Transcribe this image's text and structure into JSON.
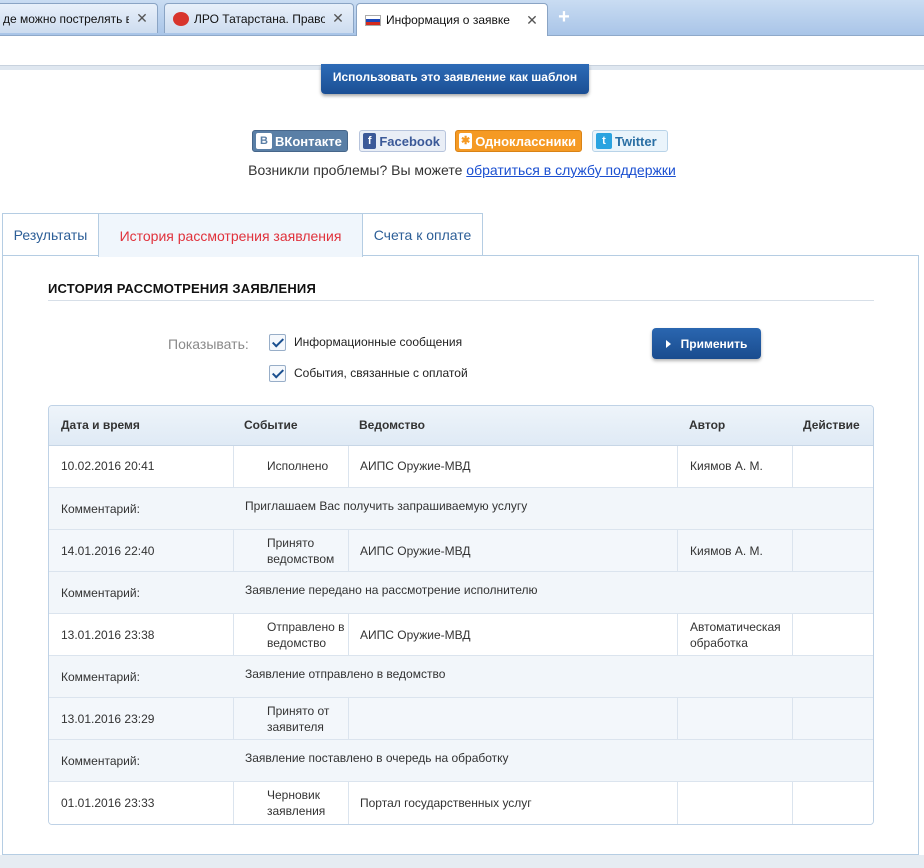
{
  "browser": {
    "tabs": [
      {
        "title": "де можно пострелять в "
      },
      {
        "title": "ЛРО Татарстана. Правово"
      },
      {
        "title": "Информация о заявке"
      }
    ],
    "new_tab": "+"
  },
  "page": {
    "template_button": "Использовать это заявление как шаблон",
    "share": {
      "vk": "ВКонтакте",
      "facebook": "Facebook",
      "ok": "Одноклассники",
      "twitter": "Twitter"
    },
    "support_text": "Возникли проблемы? Вы можете ",
    "support_link": "обратиться в службу поддержки",
    "tabs": [
      "Результаты",
      "История рассмотрения заявления",
      "Счета к оплате"
    ],
    "section_title": "ИСТОРИЯ РАССМОТРЕНИЯ ЗАЯВЛЕНИЯ",
    "filter": {
      "label": "Показывать:",
      "options": [
        "Информационные сообщения",
        "События, связанные с оплатой"
      ],
      "apply": "Применить"
    },
    "table": {
      "headers": [
        "Дата и время",
        "Событие",
        "Ведомство",
        "Автор",
        "Действие"
      ],
      "comment_label": "Комментарий:",
      "rows": [
        {
          "date": "10.02.2016 20:41",
          "event": "Исполнено",
          "agency": "АИПС Оружие-МВД",
          "author": "Киямов А. М.",
          "comment": "Приглашаем Вас получить запрашиваемую услугу"
        },
        {
          "date": "14.01.2016 22:40",
          "event": "Принято ведомством",
          "agency": "АИПС Оружие-МВД",
          "author": "Киямов А. М.",
          "comment": "Заявление передано на рассмотрение исполнителю"
        },
        {
          "date": "13.01.2016 23:38",
          "event": "Отправлено в ведомство",
          "agency": "АИПС Оружие-МВД",
          "author": "Автоматическая обработка",
          "comment": "Заявление отправлено в ведомство"
        },
        {
          "date": "13.01.2016 23:29",
          "event": "Принято от заявителя",
          "agency": "",
          "author": "",
          "comment": "Заявление поставлено в очередь на обработку"
        },
        {
          "date": "01.01.2016 23:33",
          "event": "Черновик заявления",
          "agency": "Портал государственных услуг",
          "author": "",
          "comment": ""
        }
      ]
    }
  }
}
